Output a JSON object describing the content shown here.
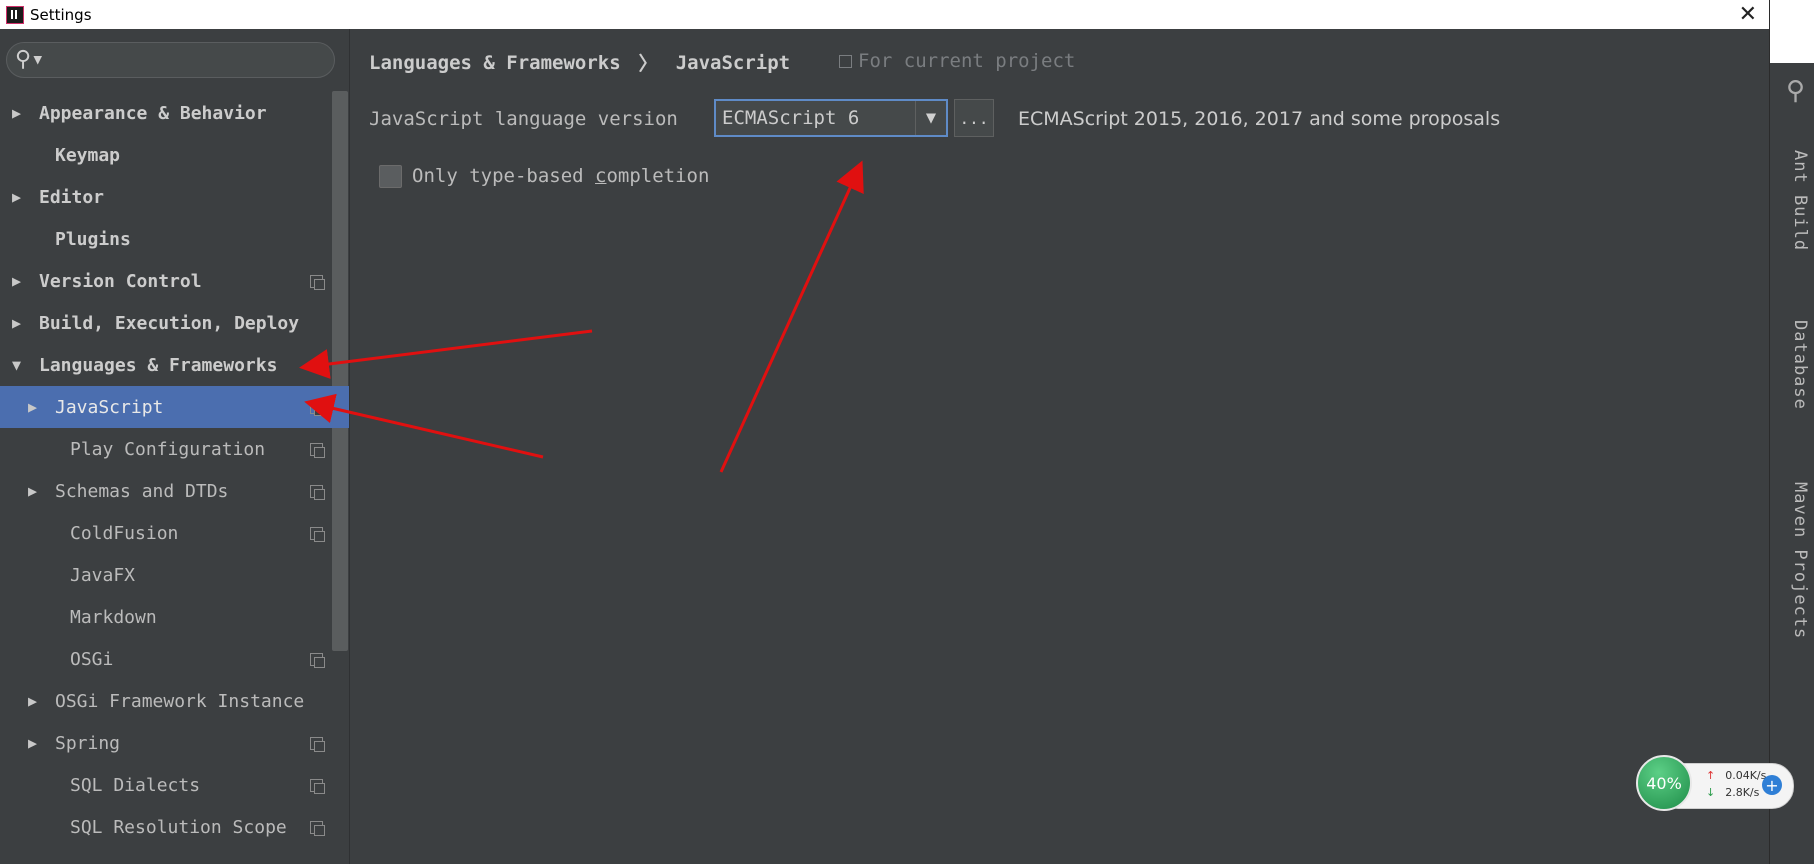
{
  "window": {
    "title": "Settings",
    "close_glyph": "✕"
  },
  "search": {
    "icon": "search-icon",
    "glyph": "⚲▾"
  },
  "sidebar": {
    "items": [
      {
        "label": "Appearance & Behavior",
        "arrow": "▶",
        "bold": true
      },
      {
        "label": "Keymap",
        "arrow": "",
        "bold": true
      },
      {
        "label": "Editor",
        "arrow": "▶",
        "bold": true
      },
      {
        "label": "Plugins",
        "arrow": "",
        "bold": true
      },
      {
        "label": "Version Control",
        "arrow": "▶",
        "bold": true,
        "copy": true
      },
      {
        "label": "Build, Execution, Deploy",
        "arrow": "▶",
        "bold": true
      },
      {
        "label": "Languages & Frameworks",
        "arrow": "▼",
        "bold": true
      },
      {
        "label": "JavaScript",
        "arrow": "▶",
        "selected": true,
        "copy": true
      },
      {
        "label": "Play Configuration",
        "arrow": "",
        "copy": true
      },
      {
        "label": "Schemas and DTDs",
        "arrow": "▶",
        "copy": true
      },
      {
        "label": "ColdFusion",
        "arrow": "",
        "copy": true
      },
      {
        "label": "JavaFX",
        "arrow": ""
      },
      {
        "label": "Markdown",
        "arrow": ""
      },
      {
        "label": "OSGi",
        "arrow": "",
        "copy": true
      },
      {
        "label": "OSGi Framework Instance",
        "arrow": "▶"
      },
      {
        "label": "Spring",
        "arrow": "▶",
        "copy": true
      },
      {
        "label": "SQL Dialects",
        "arrow": "",
        "copy": true
      },
      {
        "label": "SQL Resolution Scope",
        "arrow": "",
        "copy": true
      }
    ]
  },
  "main": {
    "breadcrumb": {
      "parent": "Languages & Frameworks",
      "separator": "〉",
      "current": "JavaScript"
    },
    "scope_text": "For current project",
    "language_version_label": "JavaScript language version",
    "language_version_value": "ECMAScript 6",
    "dropdown_arrow": "▼",
    "dots_label": "...",
    "version_description": "ECMAScript 2015, 2016, 2017 and some proposals",
    "checkbox_label_pre": "Only type-based ",
    "checkbox_label_underlined": "c",
    "checkbox_label_post": "ompletion"
  },
  "tool_windows": [
    "Ant Build",
    "Database",
    "Maven Projects"
  ],
  "widget": {
    "percent": "40%",
    "upload": "0.04K/s",
    "download": "2.8K/s",
    "up_glyph": "↑",
    "down_glyph": "↓",
    "plus": "+"
  },
  "colors": {
    "accent": "#4b6eaf",
    "annotation": "#e01010",
    "background": "#3c3f41"
  }
}
